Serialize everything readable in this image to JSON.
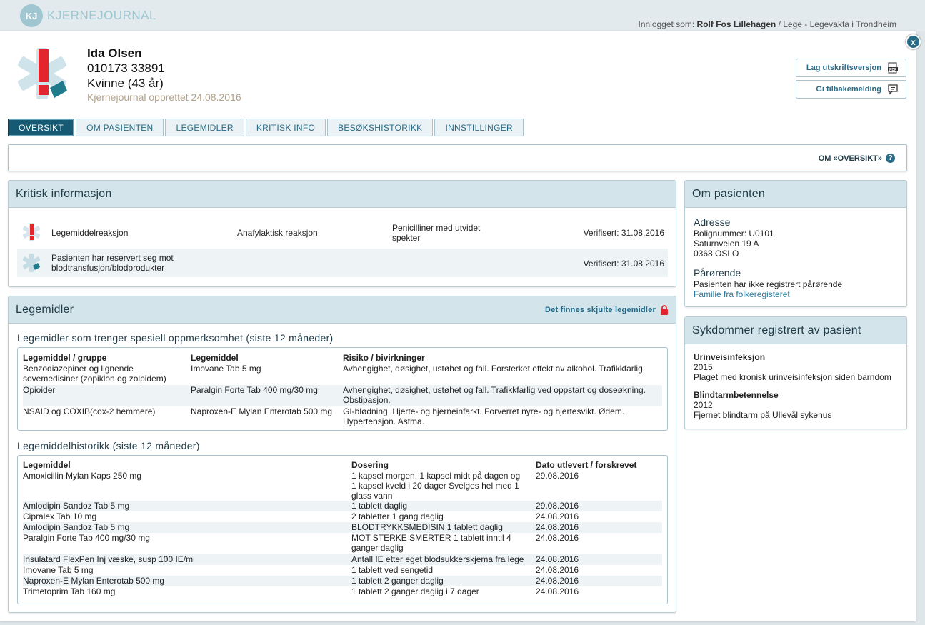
{
  "app": {
    "logo_mark": "KJ",
    "logo_text": "KJERNEJOURNAL",
    "logged_in_prefix": "Innlogget som:",
    "user_name": "Rolf Fos Lillehagen",
    "user_role": "/ Lege - Legevakta i Trondheim",
    "close_label": "x"
  },
  "patient": {
    "name": "Ida Olsen",
    "ssn": "010173 33891",
    "gender_age": "Kvinne (43 år)",
    "created": "Kjernejournal opprettet 24.08.2016"
  },
  "actions": {
    "print_label": "Lag utskriftsversjon",
    "feedback_label": "Gi tilbakemelding"
  },
  "tabs": [
    "OVERSIKT",
    "OM PASIENTEN",
    "LEGEMIDLER",
    "KRITISK INFO",
    "BESØKSHISTORIKK",
    "INNSTILLINGER"
  ],
  "overview": {
    "about_link": "OM «OVERSIKT»",
    "help_glyph": "?"
  },
  "critical": {
    "title": "Kritisk informasjon",
    "rows": [
      {
        "type": "Legemiddelreaksjon",
        "reaction": "Anafylaktisk reaksjon",
        "agent": "Penicilliner med utvidet spekter",
        "verified": "Verifisert: 31.08.2016"
      },
      {
        "type": "Pasienten har reservert seg mot blodtransfusjon/blodprodukter",
        "reaction": "",
        "agent": "",
        "verified": "Verifisert: 31.08.2016"
      }
    ]
  },
  "medications": {
    "title": "Legemidler",
    "hidden_link": "Det finnes skjulte legemidler",
    "special_heading": "Legemidler som trenger spesiell oppmerksomhet (siste 12 måneder)",
    "special_headers": [
      "Legemiddel / gruppe",
      "Legemiddel",
      "Risiko / bivirkninger"
    ],
    "special_rows": [
      [
        "Benzodiazepiner og lignende sovemedisiner (zopiklon og zolpidem)",
        "Imovane Tab 5 mg",
        "Avhengighet, døsighet, ustøhet og fall. Forsterket effekt av alkohol. Trafikkfarlig."
      ],
      [
        "Opioider",
        "Paralgin Forte Tab 400 mg/30 mg",
        "Avhengighet, døsighet, ustøhet og fall. Trafikkfarlig ved oppstart og doseøkning. Obstipasjon."
      ],
      [
        "NSAID og COXIB(cox-2 hemmere)",
        "Naproxen-E Mylan Enterotab 500 mg",
        "GI-blødning. Hjerte- og hjerneinfarkt. Forverret nyre- og hjertesvikt. Ødem. Hypertensjon. Astma."
      ]
    ],
    "history_heading": "Legemiddelhistorikk (siste 12 måneder)",
    "history_headers": [
      "Legemiddel",
      "Dosering",
      "Dato utlevert / forskrevet"
    ],
    "history_rows": [
      [
        "Amoxicillin Mylan Kaps 250 mg",
        "1 kapsel morgen, 1 kapsel midt på dagen og 1 kapsel kveld i 20 dager Svelges hel med 1 glass vann",
        "29.08.2016"
      ],
      [
        "Amlodipin Sandoz Tab 5 mg",
        "1 tablett daglig",
        "29.08.2016"
      ],
      [
        "Cipralex Tab 10 mg",
        "2 tabletter 1 gang daglig",
        "24.08.2016"
      ],
      [
        "Amlodipin Sandoz Tab 5 mg",
        "BLODTRYKKSMEDISIN 1 tablett daglig",
        "24.08.2016"
      ],
      [
        "Paralgin Forte Tab 400 mg/30 mg",
        "MOT STERKE SMERTER 1 tablett inntil 4 ganger daglig",
        "24.08.2016"
      ],
      [
        "Insulatard FlexPen Inj væske, susp 100 IE/ml",
        "Antall IE etter eget blodsukkerskjema fra lege",
        "24.08.2016"
      ],
      [
        "Imovane Tab 5 mg",
        "1 tablett ved sengetid",
        "24.08.2016"
      ],
      [
        "Naproxen-E Mylan Enterotab 500 mg",
        "1 tablett 2 ganger daglig",
        "24.08.2016"
      ],
      [
        "Trimetoprim Tab 160 mg",
        "1 tablett 2 ganger daglig i 7 dager",
        "24.08.2016"
      ]
    ]
  },
  "about_patient": {
    "title": "Om pasienten",
    "address_heading": "Adresse",
    "address_lines": [
      "Bolignummer: U0101",
      "Saturnveien 19 A",
      "0368 OSLO"
    ],
    "relatives_heading": "Pårørende",
    "relatives_text": "Pasienten har ikke registrert pårørende",
    "relatives_link": "Familie fra folkeregisteret"
  },
  "diseases": {
    "title": "Sykdommer registrert av pasient",
    "items": [
      {
        "name": "Urinveisinfeksjon",
        "year": "2015",
        "note": "Plaget med kronisk urinveisinfeksjon siden barndom"
      },
      {
        "name": "Blindtarmbetennelse",
        "year": "2012",
        "note": "Fjernet blindtarm på Ullevål sykehus"
      }
    ]
  },
  "colors": {
    "accent": "#155a72",
    "panel_header": "#d3e5ea",
    "critical_red": "#e3262e",
    "teal_icon": "#1f7a8c"
  }
}
